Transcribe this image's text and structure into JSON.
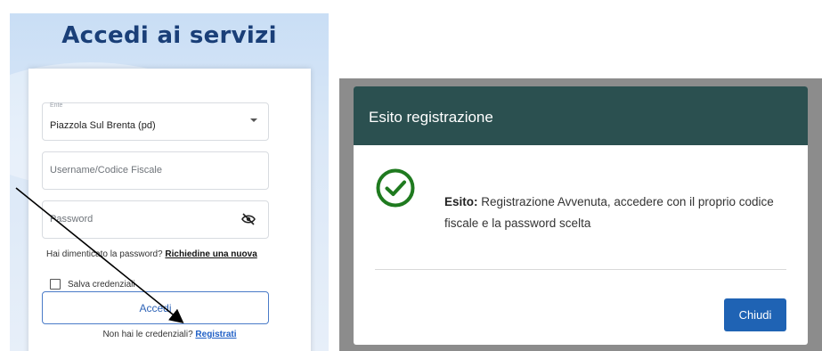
{
  "login": {
    "title": "Accedi ai servizi",
    "ente_label": "Ente",
    "ente_value": "Piazzola Sul Brenta (pd)",
    "username_placeholder": "Username/Codice Fiscale",
    "password_placeholder": "Password",
    "forgot_text": "Hai dimenticato la password?",
    "forgot_link": "Richiedine una nuova",
    "remember_label": "Salva credenziali",
    "login_button": "Accedi",
    "register_text": "Non hai le credenziali?",
    "register_link": "Registrati"
  },
  "dialog": {
    "title": "Esito registrazione",
    "status_label": "Esito:",
    "message": "Registrazione Avvenuta, accedere con il proprio codice fiscale e la password scelta",
    "close_button": "Chiudi"
  },
  "icons": {
    "dropdown": "chevron-down-icon",
    "password_visibility": "eye-off-icon",
    "success": "check-circle-icon"
  },
  "colors": {
    "title": "#1a3f78",
    "link": "#1f5fc6",
    "dialog_header": "#2b5050",
    "success": "#1f7a1f",
    "primary_button": "#1f63b4"
  }
}
